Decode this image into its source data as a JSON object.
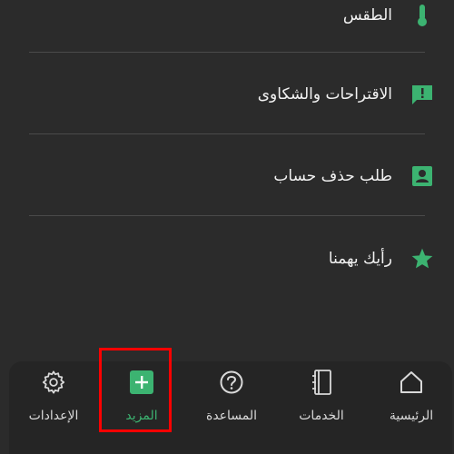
{
  "colors": {
    "accent": "#3cb371",
    "background": "#2b2b2b",
    "nav_background": "#252525",
    "highlight": "#ff0000"
  },
  "menu": {
    "items": [
      {
        "label": "الطقس",
        "icon": "thermometer-icon"
      },
      {
        "label": "الاقتراحات والشكاوى",
        "icon": "feedback-icon"
      },
      {
        "label": "طلب حذف حساب",
        "icon": "account-card-icon"
      },
      {
        "label": "رأيك يهمنا",
        "icon": "star-icon"
      }
    ]
  },
  "bottom_nav": {
    "items": [
      {
        "label": "الرئيسية",
        "icon": "home-icon",
        "active": false
      },
      {
        "label": "الخدمات",
        "icon": "notebook-icon",
        "active": false
      },
      {
        "label": "المساعدة",
        "icon": "help-icon",
        "active": false
      },
      {
        "label": "المزيد",
        "icon": "plus-box-icon",
        "active": true
      },
      {
        "label": "الإعدادات",
        "icon": "gear-icon",
        "active": false
      }
    ]
  }
}
